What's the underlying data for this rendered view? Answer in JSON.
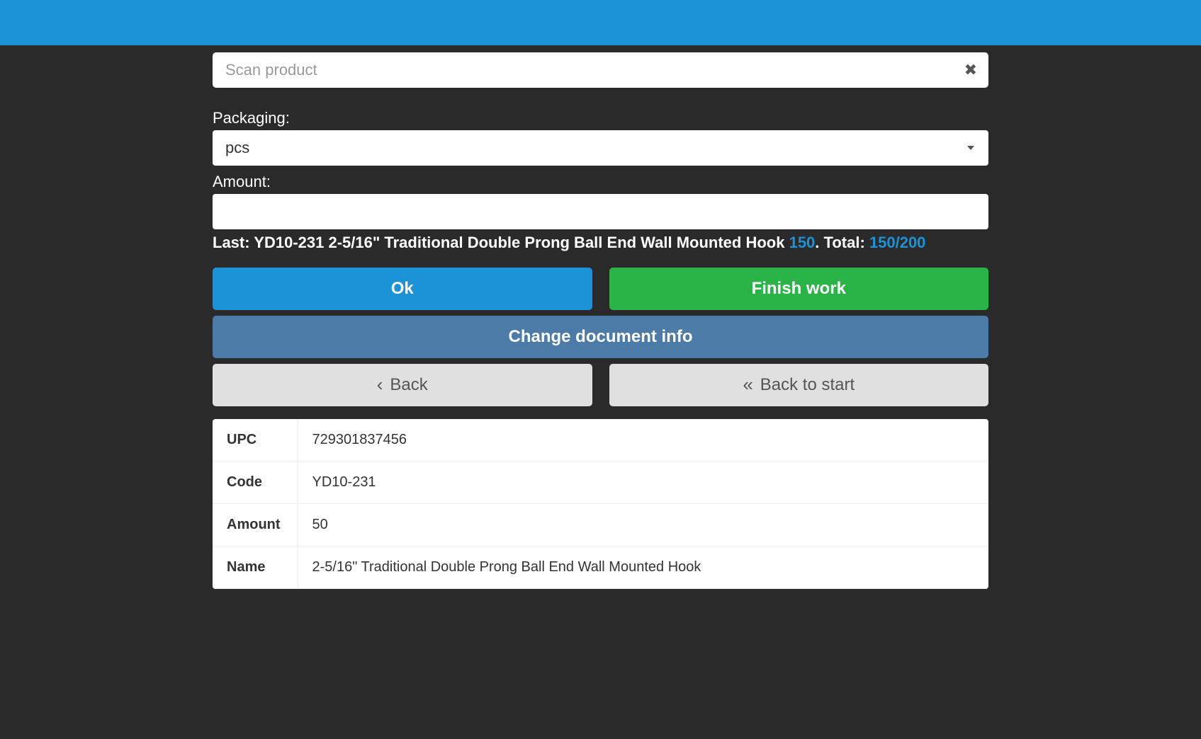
{
  "search": {
    "placeholder": "Scan product",
    "value": ""
  },
  "packaging": {
    "label": "Packaging:",
    "selected": "pcs"
  },
  "amount": {
    "label": "Amount:",
    "value": ""
  },
  "status": {
    "last_prefix": "Last: ",
    "last_text": "YD10-231 2-5/16\" Traditional Double Prong Ball End Wall Mounted Hook ",
    "last_count": "150",
    "dot": ". ",
    "total_label": "Total: ",
    "total_value": "150/200"
  },
  "buttons": {
    "ok": "Ok",
    "finish_work": "Finish work",
    "change_doc": "Change document info",
    "back": "Back",
    "back_to_start": "Back to start"
  },
  "info": {
    "upc_label": "UPC",
    "upc_value": "729301837456",
    "code_label": "Code",
    "code_value": "YD10-231",
    "amount_label": "Amount",
    "amount_value": "50",
    "name_label": "Name",
    "name_value": "2-5/16\" Traditional Double Prong Ball End Wall Mounted Hook"
  }
}
